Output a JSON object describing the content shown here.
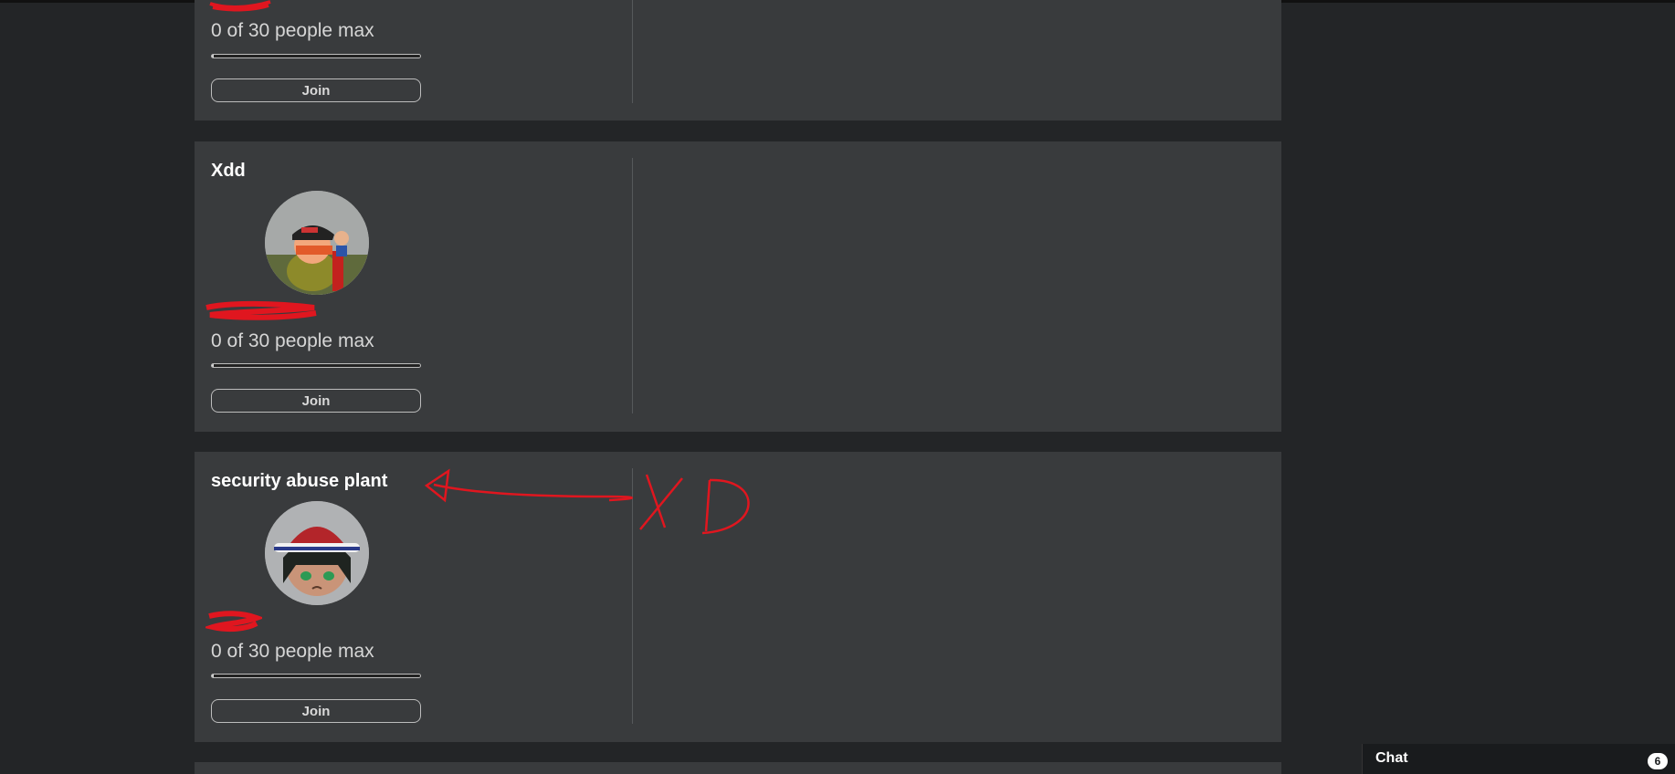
{
  "servers": [
    {
      "title": "",
      "owner": "",
      "capacity": "0 of 30 people max",
      "fill_fraction": 0,
      "join_label": "Join"
    },
    {
      "title": "Xdd",
      "owner": "",
      "capacity": "0 of 30 people max",
      "fill_fraction": 0,
      "join_label": "Join"
    },
    {
      "title": "security abuse plant",
      "owner": "",
      "capacity": "0 of 30 people max",
      "fill_fraction": 0,
      "join_label": "Join"
    }
  ],
  "annotation": {
    "text": "XD",
    "color": "#e0161f"
  },
  "chat": {
    "label": "Chat",
    "count": "6"
  },
  "colors": {
    "background": "#232527",
    "card": "#393b3d",
    "redaction": "#e0161f"
  }
}
